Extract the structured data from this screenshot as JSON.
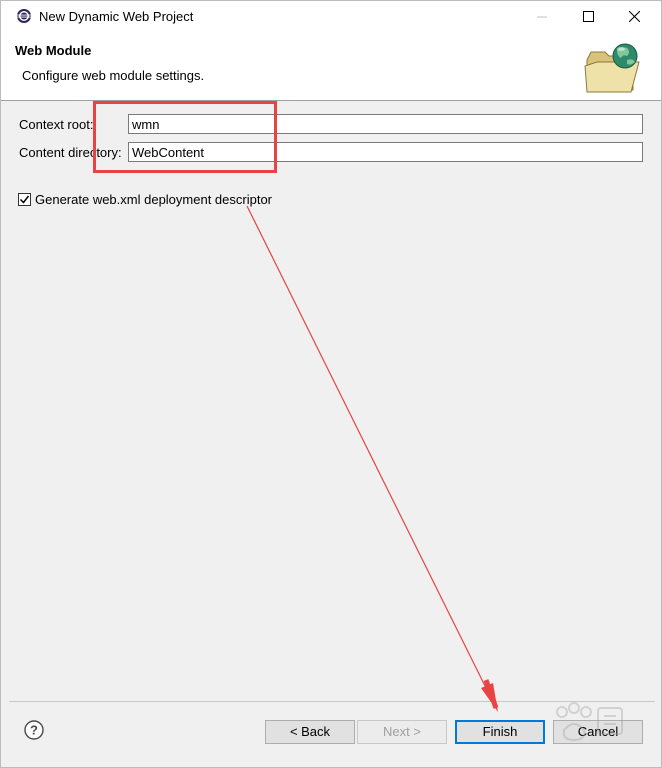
{
  "window": {
    "title": "New Dynamic Web Project"
  },
  "header": {
    "title": "Web Module",
    "description": "Configure web module settings."
  },
  "form": {
    "context_root": {
      "label": "Context root:",
      "value": "wmn"
    },
    "content_directory": {
      "label": "Content directory:",
      "value": "WebContent"
    },
    "generate_descriptor": {
      "label": "Generate web.xml deployment descriptor",
      "checked": true
    }
  },
  "buttons": {
    "back": "< Back",
    "next": "Next >",
    "finish": "Finish",
    "cancel": "Cancel"
  },
  "icons": {
    "app": "eclipse-icon",
    "header": "web-folder-globe-icon",
    "help": "help-icon"
  },
  "colors": {
    "annotation": "#e84444",
    "default_button_border": "#0078d7"
  }
}
